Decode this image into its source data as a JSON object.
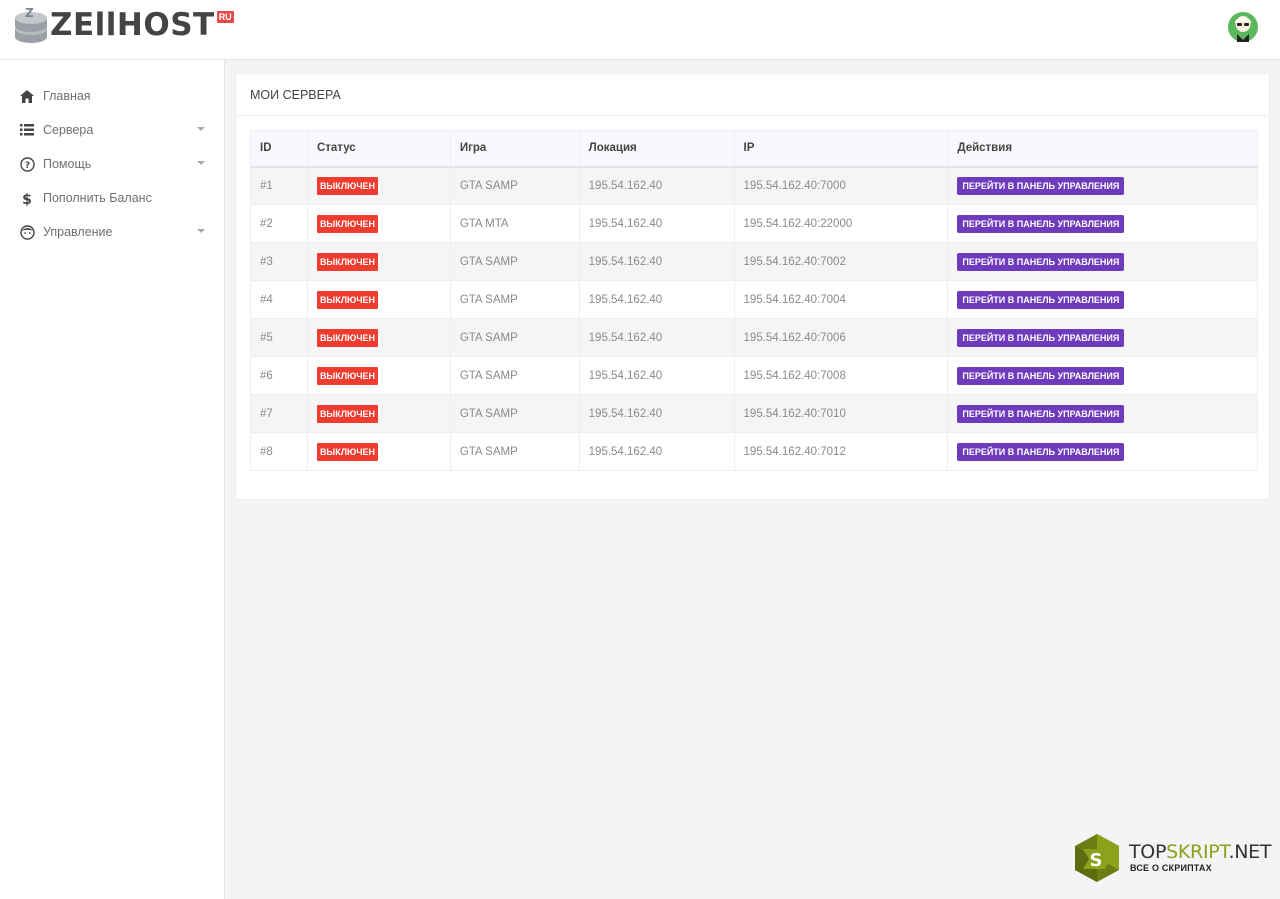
{
  "brand": {
    "name": "ZEllHOST",
    "tld": "RU"
  },
  "sidebar": {
    "items": [
      {
        "label": "Главная",
        "icon": "home-icon",
        "has_caret": false
      },
      {
        "label": "Сервера",
        "icon": "server-list-icon",
        "has_caret": true
      },
      {
        "label": "Помощь",
        "icon": "help-icon",
        "has_caret": true
      },
      {
        "label": "Пополнить Баланс",
        "icon": "dollar-icon",
        "has_caret": false
      },
      {
        "label": "Управление",
        "icon": "user-face-icon",
        "has_caret": true
      }
    ]
  },
  "panel": {
    "title": "МОИ СЕРВЕРА"
  },
  "table": {
    "headers": [
      "ID",
      "Статус",
      "Игра",
      "Локация",
      "IP",
      "Действия"
    ],
    "rows": [
      {
        "id": "#1",
        "status": "ВЫКЛЮЧЕН",
        "game": "GTA SAMP",
        "location": "195.54.162.40",
        "ip": "195.54.162.40:7000",
        "action": "ПЕРЕЙТИ В ПАНЕЛЬ УПРАВЛЕНИЯ"
      },
      {
        "id": "#2",
        "status": "ВЫКЛЮЧЕН",
        "game": "GTA MTA",
        "location": "195.54.162.40",
        "ip": "195.54.162.40:22000",
        "action": "ПЕРЕЙТИ В ПАНЕЛЬ УПРАВЛЕНИЯ"
      },
      {
        "id": "#3",
        "status": "ВЫКЛЮЧЕН",
        "game": "GTA SAMP",
        "location": "195.54.162.40",
        "ip": "195.54.162.40:7002",
        "action": "ПЕРЕЙТИ В ПАНЕЛЬ УПРАВЛЕНИЯ"
      },
      {
        "id": "#4",
        "status": "ВЫКЛЮЧЕН",
        "game": "GTA SAMP",
        "location": "195.54.162.40",
        "ip": "195.54.162.40:7004",
        "action": "ПЕРЕЙТИ В ПАНЕЛЬ УПРАВЛЕНИЯ"
      },
      {
        "id": "#5",
        "status": "ВЫКЛЮЧЕН",
        "game": "GTA SAMP",
        "location": "195.54.162.40",
        "ip": "195.54.162.40:7006",
        "action": "ПЕРЕЙТИ В ПАНЕЛЬ УПРАВЛЕНИЯ"
      },
      {
        "id": "#6",
        "status": "ВЫКЛЮЧЕН",
        "game": "GTA SAMP",
        "location": "195.54.162.40",
        "ip": "195.54.162.40:7008",
        "action": "ПЕРЕЙТИ В ПАНЕЛЬ УПРАВЛЕНИЯ"
      },
      {
        "id": "#7",
        "status": "ВЫКЛЮЧЕН",
        "game": "GTA SAMP",
        "location": "195.54.162.40",
        "ip": "195.54.162.40:7010",
        "action": "ПЕРЕЙТИ В ПАНЕЛЬ УПРАВЛЕНИЯ"
      },
      {
        "id": "#8",
        "status": "ВЫКЛЮЧЕН",
        "game": "GTA SAMP",
        "location": "195.54.162.40",
        "ip": "195.54.162.40:7012",
        "action": "ПЕРЕЙТИ В ПАНЕЛЬ УПРАВЛЕНИЯ"
      }
    ]
  },
  "watermark": {
    "letter": "S",
    "name_part1": "TOP",
    "name_part2": "SKRIPT",
    "name_part3": ".NET",
    "subtitle": "ВСЕ О СКРИПТАХ"
  },
  "colors": {
    "status_off": "#f03c2e",
    "action_button": "#6f3bbd",
    "brand_ru": "#e94b4b",
    "watermark_green": "#8aa31a"
  }
}
